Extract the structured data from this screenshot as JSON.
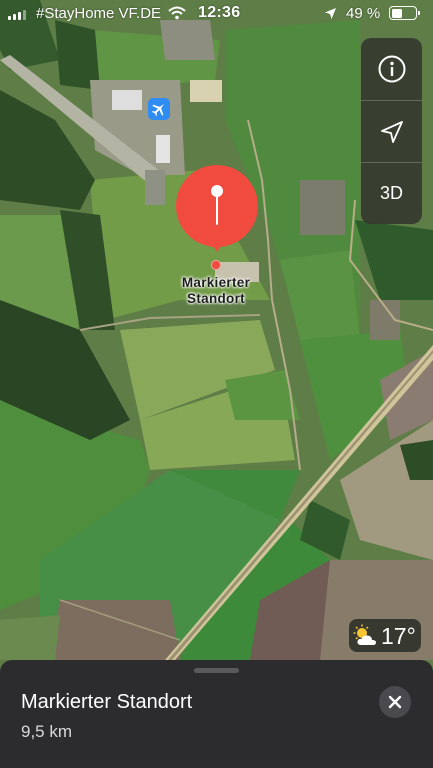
{
  "status_bar": {
    "carrier": "#StayHome VF.DE",
    "time": "12:36",
    "battery_percent": "49 %",
    "battery_level": 0.49
  },
  "map": {
    "style": "satellite",
    "icons": [
      "airport-icon"
    ]
  },
  "controls": {
    "info_icon": "info-icon",
    "location_icon": "location-arrow-icon",
    "mode_label": "3D"
  },
  "pin": {
    "label_line1": "Markierter",
    "label_line2": "Standort",
    "color": "#f04b3e"
  },
  "weather": {
    "icon": "partly-sunny-icon",
    "temperature": "17°"
  },
  "sheet": {
    "title": "Markierter Standort",
    "distance": "9,5 km",
    "close_icon": "close-icon"
  },
  "colors": {
    "accent_blue": "#2f8cf0",
    "sheet_bg": "#2c2c2e"
  }
}
